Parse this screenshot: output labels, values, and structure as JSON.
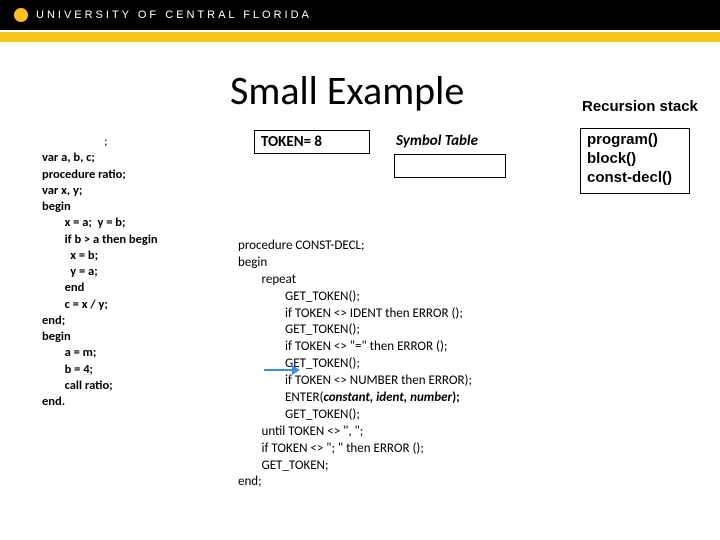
{
  "header": {
    "brand": "UNIVERSITY OF CENTRAL FLORIDA"
  },
  "title": "Small Example",
  "recursion_label": "Recursion stack",
  "token_box": "TOKEN= 8",
  "symbol_label": "Symbol Table",
  "stack": {
    "l0": "program()",
    "l1": "block()",
    "l2": "const-decl()"
  },
  "code_left": {
    "l0": "                      ;",
    "l1": "var a, b, c;",
    "l2": "procedure ratio;",
    "l3": "var x, y;",
    "l4": "begin",
    "l5": "        x = a;  y = b;",
    "l6": "        if b > a then begin",
    "l7": "          x = b;",
    "l8": "          y = a;",
    "l9": "        end",
    "l10": "        c = x / y;",
    "l11": "end;",
    "l12": "begin",
    "l13": "        a = m;",
    "l14": "        b = 4;",
    "l15": "        call ratio;",
    "l16": "end."
  },
  "code_right": {
    "l0": "procedure CONST-DECL;",
    "l1": "begin",
    "l2": "        repeat",
    "l3": "                GET_TOKEN();",
    "l4": "                if TOKEN <> IDENT then ERROR ();",
    "l5": "                GET_TOKEN();",
    "l6": "                if TOKEN <> \"=\" then ERROR ();",
    "l7": "                GET_TOKEN();",
    "l8": "                if TOKEN <> NUMBER then ERROR);",
    "l9a": "                ENTER(",
    "l9b": "constant, ident, number",
    "l9c": ");",
    "l10": "                GET_TOKEN();",
    "l11": "        until TOKEN <> \", \";",
    "l12": "        if TOKEN <> \"; \" then ERROR ();",
    "l13": "        GET_TOKEN;",
    "l14": "end;"
  }
}
